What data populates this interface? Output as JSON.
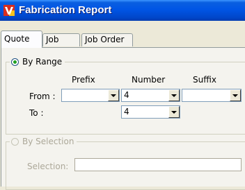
{
  "window": {
    "title": "Fabrication Report",
    "icon": "app-v-icon"
  },
  "tabs": [
    {
      "label": "Quote",
      "active": true
    },
    {
      "label": "Job",
      "active": false
    },
    {
      "label": "Job Order",
      "active": false
    }
  ],
  "by_range": {
    "label": "By Range",
    "selected": true,
    "columns": {
      "prefix": "Prefix",
      "number": "Number",
      "suffix": "Suffix"
    },
    "from": {
      "label": "From :",
      "prefix": "",
      "number": "4",
      "suffix": ""
    },
    "to": {
      "label": "To :",
      "number": "4"
    }
  },
  "by_selection": {
    "label": "By Selection",
    "selected": false,
    "enabled": false,
    "selection_label": "Selection:",
    "selection_value": ""
  },
  "colors": {
    "title_bar": "#0055e5",
    "accent_check": "#21a121",
    "face": "#ece9d8"
  }
}
